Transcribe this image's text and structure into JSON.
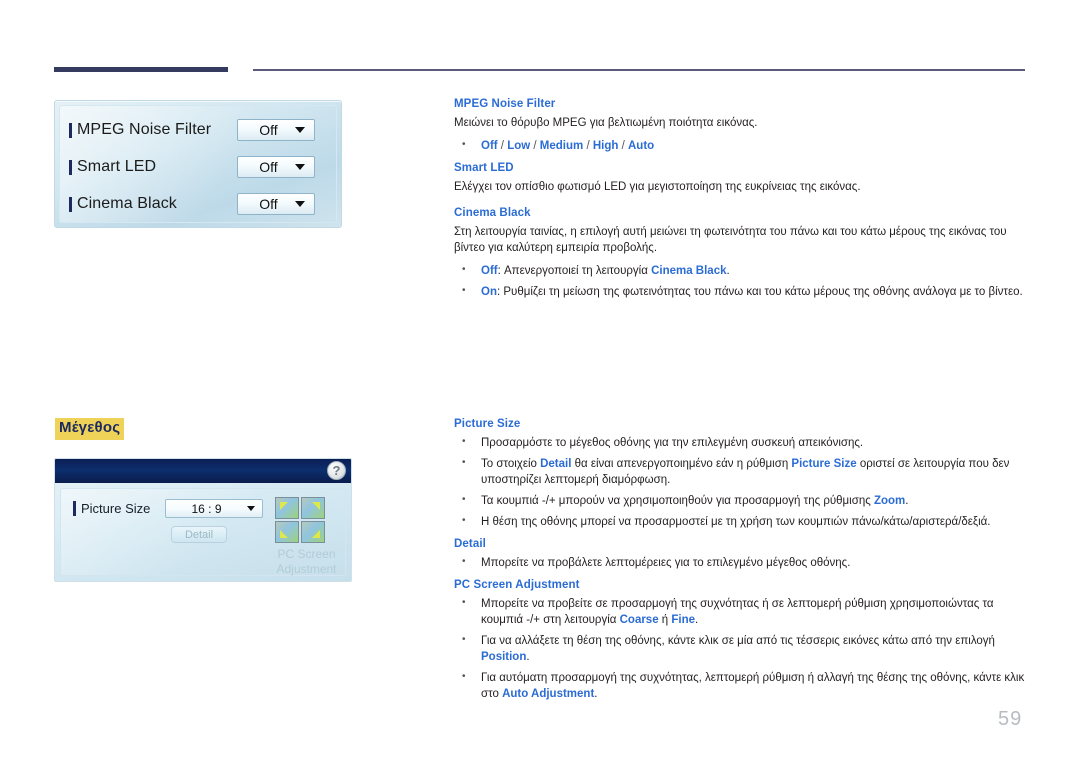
{
  "page": {
    "number": "59"
  },
  "osd_picture_options": {
    "rows": [
      {
        "label": "MPEG Noise Filter",
        "value": "Off"
      },
      {
        "label": "Smart LED",
        "value": "Off"
      },
      {
        "label": "Cinema Black",
        "value": "Off"
      }
    ]
  },
  "section_heading": {
    "label": "Μέγεθος"
  },
  "osd_picture_size": {
    "help_icon": "question-mark-icon",
    "label": "Picture Size",
    "value": "16 : 9",
    "detail_button": "Detail",
    "pc_screen_adjustment": "PC Screen\nAdjustment",
    "pc_screen_adjustment_line1": "PC Screen",
    "pc_screen_adjustment_line2": "Adjustment"
  },
  "doc_top": {
    "mpeg_noise_filter": {
      "heading": "MPEG Noise Filter",
      "body": "Μειώνει το θόρυβο MPEG για βελτιωμένη ποιότητα εικόνας.",
      "options": [
        "Off",
        "Low",
        "Medium",
        "High",
        "Auto"
      ]
    },
    "smart_led": {
      "heading": "Smart LED",
      "body": "Ελέγχει τον οπίσθιο φωτισμό LED για μεγιστοποίηση της ευκρίνειας της εικόνας."
    },
    "cinema_black": {
      "heading": "Cinema Black",
      "body": "Στη λειτουργία ταινίας, η επιλογή αυτή μειώνει τη φωτεινότητα του πάνω και του κάτω μέρους της εικόνας του βίντεο για καλύτερη εμπειρία προβολής.",
      "bullet_off_key": "Off",
      "bullet_off_text_a": ": Απενεργοποιεί τη λειτουργία ",
      "bullet_off_link": "Cinema Black",
      "bullet_off_text_b": ".",
      "bullet_on_key": "On",
      "bullet_on_text": ": Ρυθμίζει τη μείωση της φωτεινότητας του πάνω και του κάτω μέρους της οθόνης ανάλογα με το βίντεο."
    }
  },
  "doc_bottom": {
    "picture_size": {
      "heading": "Picture Size",
      "b1": "Προσαρμόστε το μέγεθος οθόνης για την επιλεγμένη συσκευή απεικόνισης.",
      "b2_a": "Το στοιχείο ",
      "b2_link1": "Detail",
      "b2_b": " θα είναι απενεργοποιημένο εάν η ρύθμιση ",
      "b2_link2": "Picture Size",
      "b2_c": " οριστεί σε λειτουργία που δεν υποστηρίζει λεπτομερή διαμόρφωση.",
      "b3_a": "Τα κουμπιά -/+ μπορούν να χρησιμοποιηθούν για προσαρμογή της ρύθμισης ",
      "b3_link": "Zoom",
      "b3_b": ".",
      "b4": "Η θέση της οθόνης μπορεί να προσαρμοστεί με τη χρήση των κουμπιών πάνω/κάτω/αριστερά/δεξιά."
    },
    "detail": {
      "heading": "Detail",
      "b1": "Μπορείτε να προβάλετε λεπτομέρειες για το επιλεγμένο μέγεθος οθόνης."
    },
    "pc_screen_adjustment": {
      "heading": "PC Screen Adjustment",
      "b1_a": "Μπορείτε να προβείτε σε προσαρμογή της συχνότητας ή σε λεπτομερή ρύθμιση χρησιμοποιώντας τα κουμπιά -/+ στη λειτουργία ",
      "b1_link1": "Coarse",
      "b1_b": " ή ",
      "b1_link2": "Fine",
      "b1_c": ".",
      "b2_a": "Για να αλλάξετε τη θέση της οθόνης, κάντε κλικ σε μία από τις τέσσερις εικόνες κάτω από την επιλογή ",
      "b2_link": "Position",
      "b2_b": ".",
      "b3_a": "Για αυτόματη προσαρμογή της συχνότητας, λεπτομερή ρύθμιση ή αλλαγή της θέσης της οθόνης, κάντε κλικ στο ",
      "b3_link": "Auto Adjustment",
      "b3_b": "."
    }
  }
}
